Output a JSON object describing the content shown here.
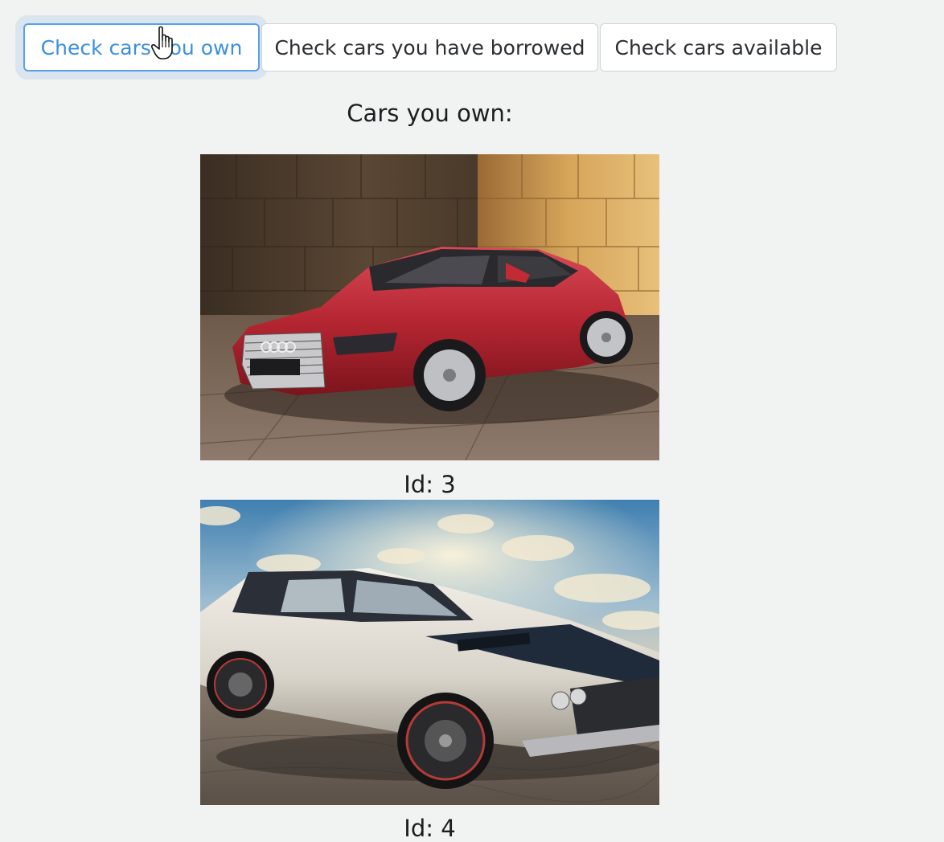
{
  "tabs": [
    {
      "label": "Check cars you own",
      "active": true
    },
    {
      "label": "Check cars you have borrowed",
      "active": false
    },
    {
      "label": "Check cars available",
      "active": false
    }
  ],
  "section": {
    "heading": "Cars you own:"
  },
  "cars": [
    {
      "id_label": "Id: 3",
      "image": "red-sedan-photo"
    },
    {
      "id_label": "Id: 4",
      "image": "white-muscle-car-photo"
    }
  ],
  "colors": {
    "active_tab_text": "#3b8fe0",
    "active_tab_border": "#58a0e8",
    "page_background": "#f1f2f2"
  }
}
